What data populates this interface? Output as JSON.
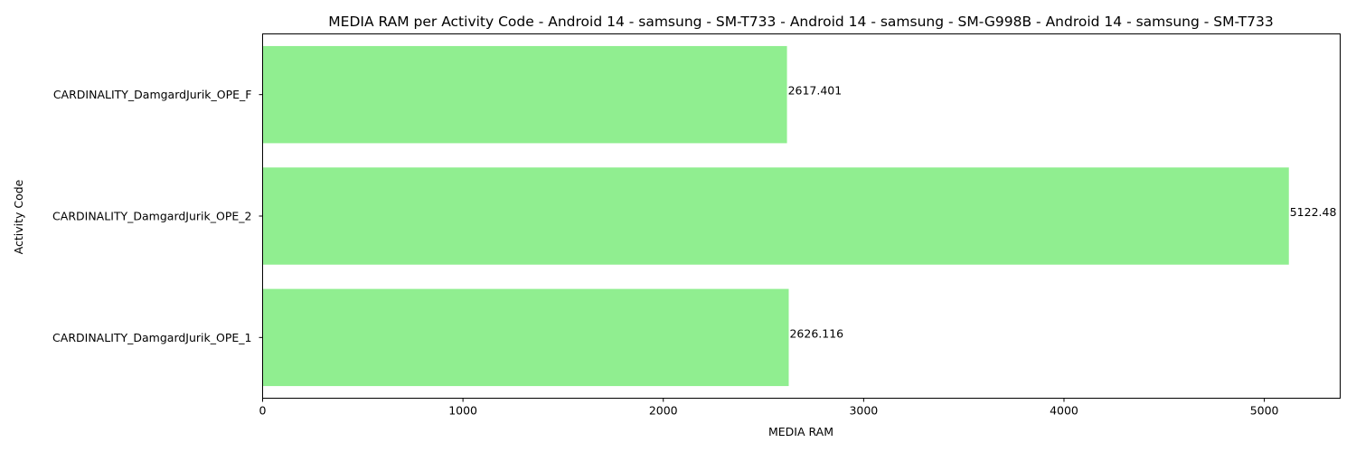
{
  "chart_data": {
    "type": "bar",
    "orientation": "horizontal",
    "title": "MEDIA RAM per Activity Code - Android 14 - samsung - SM-T733 - Android 14 - samsung - SM-G998B - Android 14 - samsung - SM-T733",
    "xlabel": "MEDIA RAM",
    "ylabel": "Activity Code",
    "categories": [
      "CARDINALITY_DamgardJurik_OPE_1",
      "CARDINALITY_DamgardJurik_OPE_2",
      "CARDINALITY_DamgardJurik_OPE_F"
    ],
    "values": [
      2626.116,
      5122.48,
      2617.401
    ],
    "value_labels": [
      "2626.116",
      "5122.48",
      "2617.401"
    ],
    "xlim": [
      0,
      5378.6
    ],
    "xticks": [
      0,
      1000,
      2000,
      3000,
      4000,
      5000
    ],
    "xtick_labels": [
      "0",
      "1000",
      "2000",
      "3000",
      "4000",
      "5000"
    ],
    "grid": false,
    "colors": {
      "bar": "#90ee90"
    }
  }
}
